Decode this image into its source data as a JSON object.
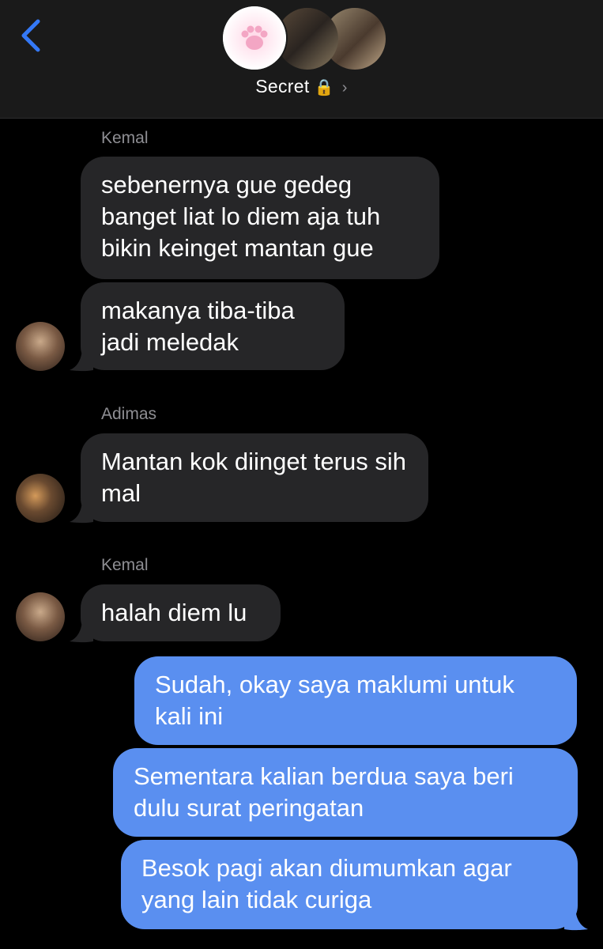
{
  "header": {
    "back_icon": "chevron-left-icon",
    "accent_color": "#3478f6",
    "group_name": "Secret",
    "lock_icon": "🔒",
    "chevron": "›",
    "avatars": [
      "paw-icon",
      "member-photo",
      "member-photo"
    ]
  },
  "messages": [
    {
      "sender": "Kemal",
      "bubbles": [
        "sebenernya gue gedeg banget liat lo diem aja tuh bikin keinget mantan gue",
        "makanya tiba-tiba jadi meledak"
      ]
    },
    {
      "sender": "Adimas",
      "bubbles": [
        "Mantan kok diinget terus sih mal"
      ]
    },
    {
      "sender": "Kemal",
      "bubbles": [
        "halah diem lu"
      ]
    },
    {
      "sender": "",
      "bubbles": [
        "Sudah, okay saya maklumi untuk kali ini",
        "Sementara kalian berdua saya beri dulu surat peringatan",
        "Besok pagi akan diumumkan agar yang lain tidak curiga"
      ]
    }
  ],
  "colors": {
    "incoming_bubble": "#262628",
    "outgoing_bubble": "#5a8ff0",
    "sender_label": "#8e8e93"
  }
}
